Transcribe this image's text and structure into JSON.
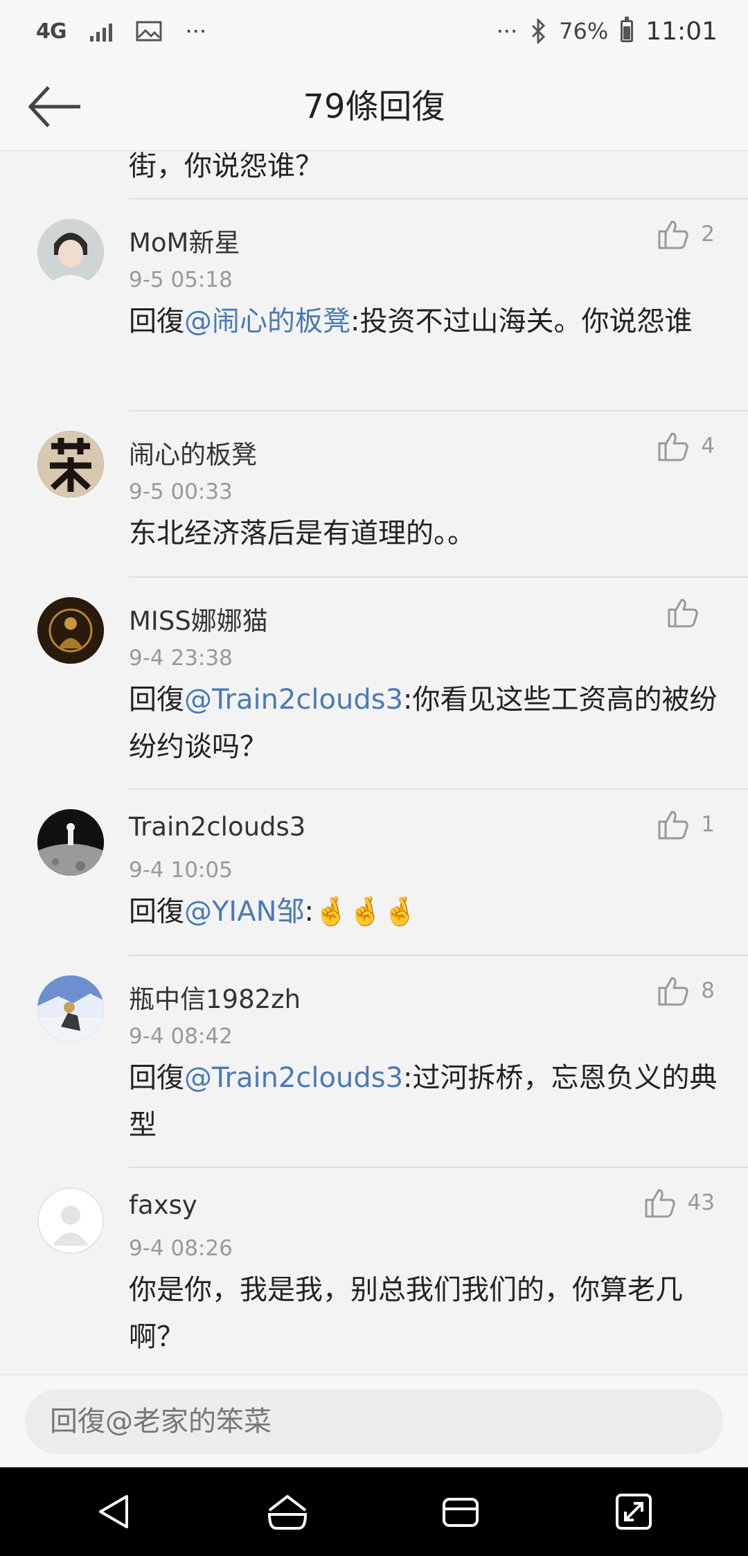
{
  "status_bar": {
    "network": "4G",
    "overflow": "···",
    "right_overflow": "···",
    "battery_percent": "76%",
    "time": "11:01"
  },
  "header": {
    "title": "79條回復"
  },
  "partial_comment": {
    "text": "街，你说怨谁？"
  },
  "comments": [
    {
      "username": "MoM新星",
      "time": "9-5 05:18",
      "reply_prefix": "回復",
      "mention": "@闹心的板凳",
      "text": ":投资不过山海关。你说怨谁",
      "likes": "2",
      "avatar_color": "#d9dcdc"
    },
    {
      "username": "闹心的板凳",
      "time": "9-5 00:33",
      "reply_prefix": "",
      "mention": "",
      "text": "东北经济落后是有道理的。。",
      "likes": "4",
      "avatar_color": "#2a2420"
    },
    {
      "username": "MISS娜娜猫",
      "time": "9-4 23:38",
      "reply_prefix": "回復",
      "mention": "@Train2clouds3",
      "text": ":你看见这些工资高的被纷纷约谈吗？",
      "likes": "",
      "avatar_color": "#3a2410"
    },
    {
      "username": "Train2clouds3",
      "time": "9-4 10:05",
      "reply_prefix": "回復",
      "mention": "@YIAN邹",
      "text": ":",
      "emoji": "🤞🤞🤞",
      "likes": "1",
      "avatar_color": "#222222"
    },
    {
      "username": "瓶中信1982zh",
      "time": "9-4 08:42",
      "reply_prefix": "回復",
      "mention": "@Train2clouds3",
      "text": ":过河拆桥，忘恩负义的典型",
      "likes": "8",
      "avatar_color": "#5a7fc0"
    },
    {
      "username": "faxsy",
      "time": "9-4 08:26",
      "reply_prefix": "",
      "mention": "",
      "text": "你是你，我是我，别总我们我们的，你算老几啊？",
      "likes": "43",
      "avatar_color": "#ffffff"
    }
  ],
  "reply_bar": {
    "placeholder": "回復@老家的笨菜"
  },
  "colors": {
    "mention": "#4a7ab5",
    "background": "#f3f3f3",
    "muted": "#999999"
  }
}
